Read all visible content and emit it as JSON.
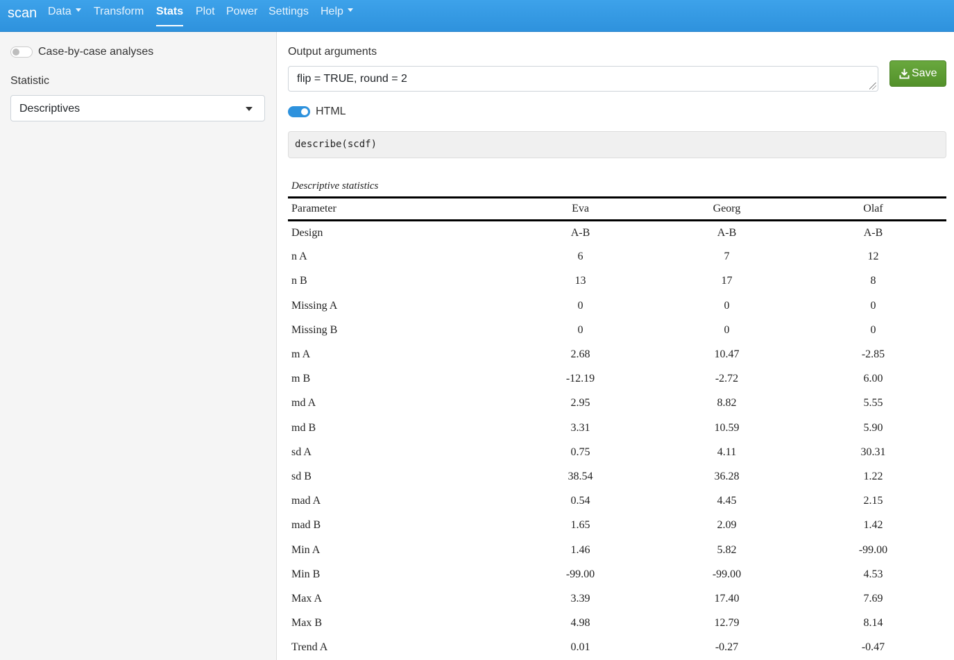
{
  "navbar": {
    "brand": "scan",
    "items": [
      {
        "label": "Data",
        "dropdown": true
      },
      {
        "label": "Transform",
        "dropdown": false
      },
      {
        "label": "Stats",
        "dropdown": false,
        "active": true
      },
      {
        "label": "Plot",
        "dropdown": false
      },
      {
        "label": "Power",
        "dropdown": false
      },
      {
        "label": "Settings",
        "dropdown": false
      },
      {
        "label": "Help",
        "dropdown": true
      }
    ]
  },
  "sidebar": {
    "case_toggle_label": "Case-by-case analyses",
    "case_toggle_on": false,
    "statistic_label": "Statistic",
    "statistic_value": "Descriptives"
  },
  "main": {
    "output_label": "Output arguments",
    "output_value": "flip = TRUE, round = 2",
    "save_label": "Save",
    "html_label": "HTML",
    "html_on": true,
    "code": "describe(scdf)"
  },
  "table": {
    "caption": "Descriptive statistics",
    "headers": [
      "Parameter",
      "Eva",
      "Georg",
      "Olaf"
    ],
    "rows": [
      [
        "Design",
        "A-B",
        "A-B",
        "A-B"
      ],
      [
        "n A",
        "6",
        "7",
        "12"
      ],
      [
        "n B",
        "13",
        "17",
        "8"
      ],
      [
        "Missing A",
        "0",
        "0",
        "0"
      ],
      [
        "Missing B",
        "0",
        "0",
        "0"
      ],
      [
        "m A",
        "2.68",
        "10.47",
        "-2.85"
      ],
      [
        "m B",
        "-12.19",
        "-2.72",
        "6.00"
      ],
      [
        "md A",
        "2.95",
        "8.82",
        "5.55"
      ],
      [
        "md B",
        "3.31",
        "10.59",
        "5.90"
      ],
      [
        "sd A",
        "0.75",
        "4.11",
        "30.31"
      ],
      [
        "sd B",
        "38.54",
        "36.28",
        "1.22"
      ],
      [
        "mad A",
        "0.54",
        "4.45",
        "2.15"
      ],
      [
        "mad B",
        "1.65",
        "2.09",
        "1.42"
      ],
      [
        "Min A",
        "1.46",
        "5.82",
        "-99.00"
      ],
      [
        "Min B",
        "-99.00",
        "-99.00",
        "4.53"
      ],
      [
        "Max A",
        "3.39",
        "17.40",
        "7.69"
      ],
      [
        "Max B",
        "4.98",
        "12.79",
        "8.14"
      ],
      [
        "Trend A",
        "0.01",
        "-0.27",
        "-0.47"
      ]
    ]
  },
  "colors": {
    "navbar": "#2e92dd",
    "save_button": "#5a9a31",
    "toggle_on": "#2e92dd"
  }
}
